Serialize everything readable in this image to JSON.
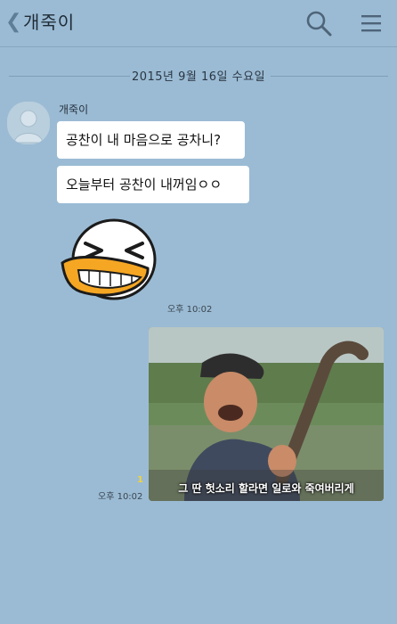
{
  "header": {
    "back_glyph": "❮",
    "title": "개죽이",
    "search_icon": "search-icon",
    "menu_icon": "menu-icon"
  },
  "date_divider": "2015년 9월 16일 수요일",
  "messages": [
    {
      "sender": "개죽이",
      "text": "공찬이 내 마음으로 공차니?"
    },
    {
      "sender": "개죽이",
      "text": "오늘부터 공찬이 내꺼임ㅇㅇ"
    }
  ],
  "incoming_time": "오후 10:02",
  "outgoing": {
    "unread_count": "1",
    "time": "오후 10:02",
    "photo_caption": "그 딴 헛소리 할라면 일로와 죽여버리게"
  },
  "colors": {
    "background": "#9bbbd4",
    "bubble": "#ffffff",
    "unread": "#f2d33a"
  }
}
